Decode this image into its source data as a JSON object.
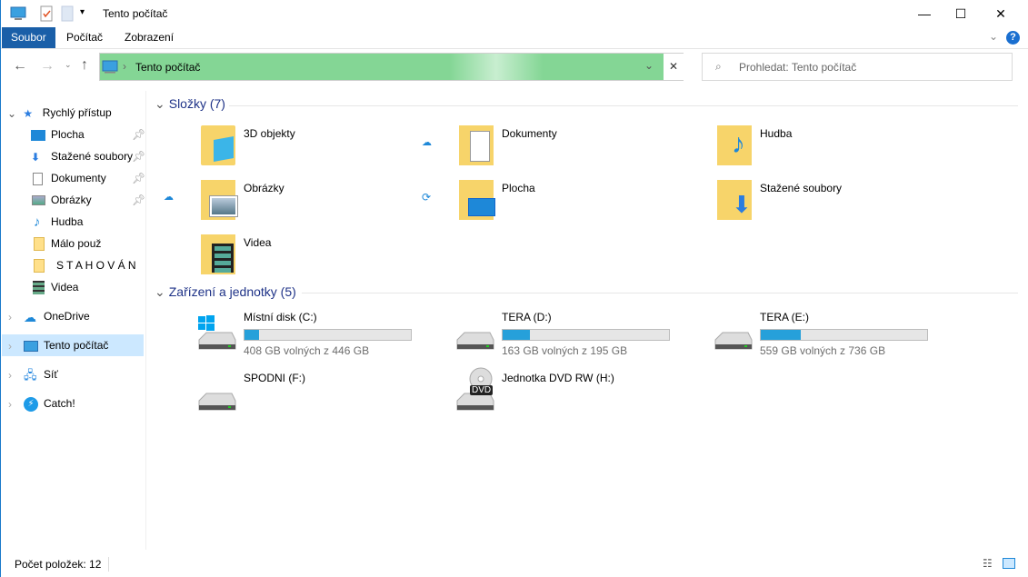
{
  "window": {
    "title": "Tento počítač",
    "minimize": "—",
    "maximize": "☐",
    "close": "✕"
  },
  "ribbon": {
    "tabs": [
      "Soubor",
      "Počítač",
      "Zobrazení"
    ],
    "help": "?"
  },
  "address": {
    "path": "Tento počítač",
    "search_placeholder": "Prohledat: Tento počítač"
  },
  "nav": {
    "quick_access": "Rychlý přístup",
    "quick_items": [
      {
        "label": "Plocha",
        "pinned": true
      },
      {
        "label": "Stažené soubory",
        "pinned": true
      },
      {
        "label": "Dokumenty",
        "pinned": true
      },
      {
        "label": "Obrázky",
        "pinned": true
      },
      {
        "label": "Hudba",
        "pinned": false
      },
      {
        "label": "Málo použ",
        "pinned": false
      },
      {
        "label": "S T A H O V Á N",
        "pinned": false
      },
      {
        "label": "Videa",
        "pinned": false
      }
    ],
    "roots": [
      "OneDrive",
      "Tento počítač",
      "Síť",
      "Catch!"
    ]
  },
  "folders": {
    "header": "Složky (7)",
    "items": [
      "3D objekty",
      "Dokumenty",
      "Hudba",
      "Obrázky",
      "Plocha",
      "Stažené soubory",
      "Videa"
    ]
  },
  "devices": {
    "header": "Zařízení a jednotky (5)",
    "items": [
      {
        "name": "Místní disk (C:)",
        "info": "408 GB volných z 446 GB",
        "used_fraction": 0.085
      },
      {
        "name": "TERA (D:)",
        "info": "163 GB volných z 195 GB",
        "used_fraction": 0.164
      },
      {
        "name": "TERA (E:)",
        "info": "559 GB volných z 736 GB",
        "used_fraction": 0.24
      },
      {
        "name": "SPODNI (F:)"
      },
      {
        "name": "Jednotka DVD RW (H:)",
        "badge": "DVD"
      }
    ]
  },
  "status": {
    "count": "Počet položek: 12"
  },
  "colors": {
    "accent": "#1a5fa8",
    "address_bg": "#84d695",
    "bar": "#26a0da",
    "selection": "#cce8ff"
  }
}
